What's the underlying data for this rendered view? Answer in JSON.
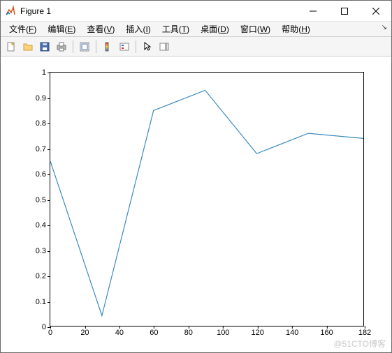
{
  "window": {
    "title": "Figure 1"
  },
  "menu": {
    "file": {
      "label": "文件",
      "accel": "F"
    },
    "edit": {
      "label": "编辑",
      "accel": "E"
    },
    "view": {
      "label": "查看",
      "accel": "V"
    },
    "insert": {
      "label": "插入",
      "accel": "I"
    },
    "tools": {
      "label": "工具",
      "accel": "T"
    },
    "desktop": {
      "label": "桌面",
      "accel": "D"
    },
    "windowm": {
      "label": "窗口",
      "accel": "W"
    },
    "help": {
      "label": "帮助",
      "accel": "H"
    }
  },
  "toolbar": {
    "icons": {
      "new": "new-figure-icon",
      "open": "open-icon",
      "save": "save-icon",
      "print": "print-icon",
      "link": "link-icon",
      "colorbar": "colorbar-icon",
      "legend": "legend-icon",
      "pointer": "pointer-icon",
      "plottools": "plottools-icon"
    }
  },
  "chart_data": {
    "type": "line",
    "x": [
      0,
      30,
      60,
      90,
      120,
      150,
      182
    ],
    "y": [
      0.65,
      0.04,
      0.85,
      0.93,
      0.68,
      0.76,
      0.74
    ],
    "xlim": [
      0,
      182
    ],
    "ylim": [
      0,
      1
    ],
    "xticks": [
      0,
      20,
      40,
      60,
      80,
      100,
      120,
      140,
      160,
      182
    ],
    "yticks": [
      0,
      0.1,
      0.2,
      0.3,
      0.4,
      0.5,
      0.6,
      0.7,
      0.8,
      0.9,
      1
    ],
    "line_color": "#3b8bc0",
    "title": "",
    "xlabel": "",
    "ylabel": ""
  },
  "watermark": "@51CTO博客"
}
